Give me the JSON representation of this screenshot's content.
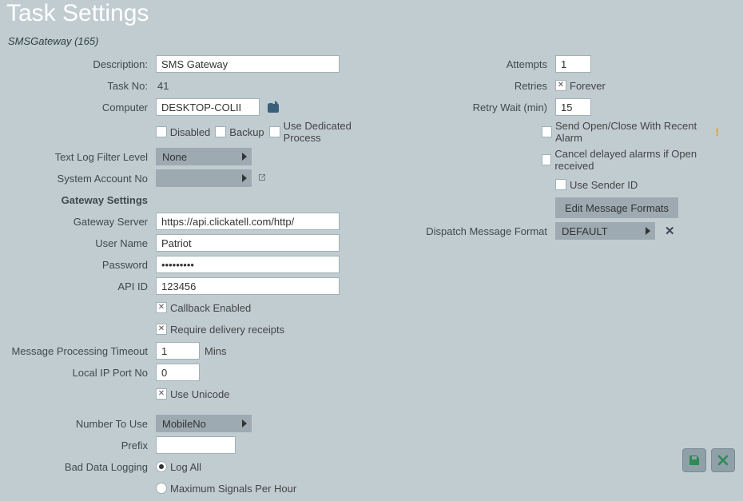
{
  "title": "Task Settings",
  "subtitle": "SMSGateway (165)",
  "left": {
    "description_label": "Description:",
    "description_value": "SMS Gateway",
    "task_no_label": "Task No:",
    "task_no_value": "41",
    "computer_label": "Computer",
    "computer_value": "DESKTOP-COLII",
    "cb_disabled_label": "Disabled",
    "cb_backup_label": "Backup",
    "cb_dedicated_label": "Use Dedicated Process",
    "log_filter_label": "Text Log Filter Level",
    "log_filter_value": "None",
    "sys_acct_label": "System Account No",
    "sys_acct_value": "",
    "gateway_heading": "Gateway Settings",
    "server_label": "Gateway Server",
    "server_value": "https://api.clickatell.com/http/",
    "user_label": "User Name",
    "user_value": "Patriot",
    "pw_label": "Password",
    "pw_value": "•••••••••",
    "api_label": "API ID",
    "api_value": "123456",
    "cb_callback_label": "Callback Enabled",
    "cb_receipts_label": "Require delivery receipts",
    "timeout_label": "Message Processing Timeout",
    "timeout_value": "1",
    "timeout_unit": "Mins",
    "port_label": "Local IP Port No",
    "port_value": "0",
    "cb_unicode_label": "Use Unicode",
    "number_label": "Number To Use",
    "number_value": "MobileNo",
    "prefix_label": "Prefix",
    "prefix_value": "",
    "bad_data_label": "Bad Data Logging",
    "radio_logall_label": "Log All",
    "radio_max_label": "Maximum Signals Per Hour"
  },
  "right": {
    "attempts_label": "Attempts",
    "attempts_value": "1",
    "retries_label": "Retries",
    "retries_cb_label": "Forever",
    "retry_wait_label": "Retry Wait (min)",
    "retry_wait_value": "15",
    "cb_send_open_label": "Send Open/Close With Recent Alarm",
    "cb_cancel_label": "Cancel delayed alarms if Open received",
    "cb_sender_label": "Use Sender ID",
    "edit_formats_label": "Edit Message Formats",
    "dispatch_label": "Dispatch Message Format",
    "dispatch_value": "DEFAULT"
  }
}
